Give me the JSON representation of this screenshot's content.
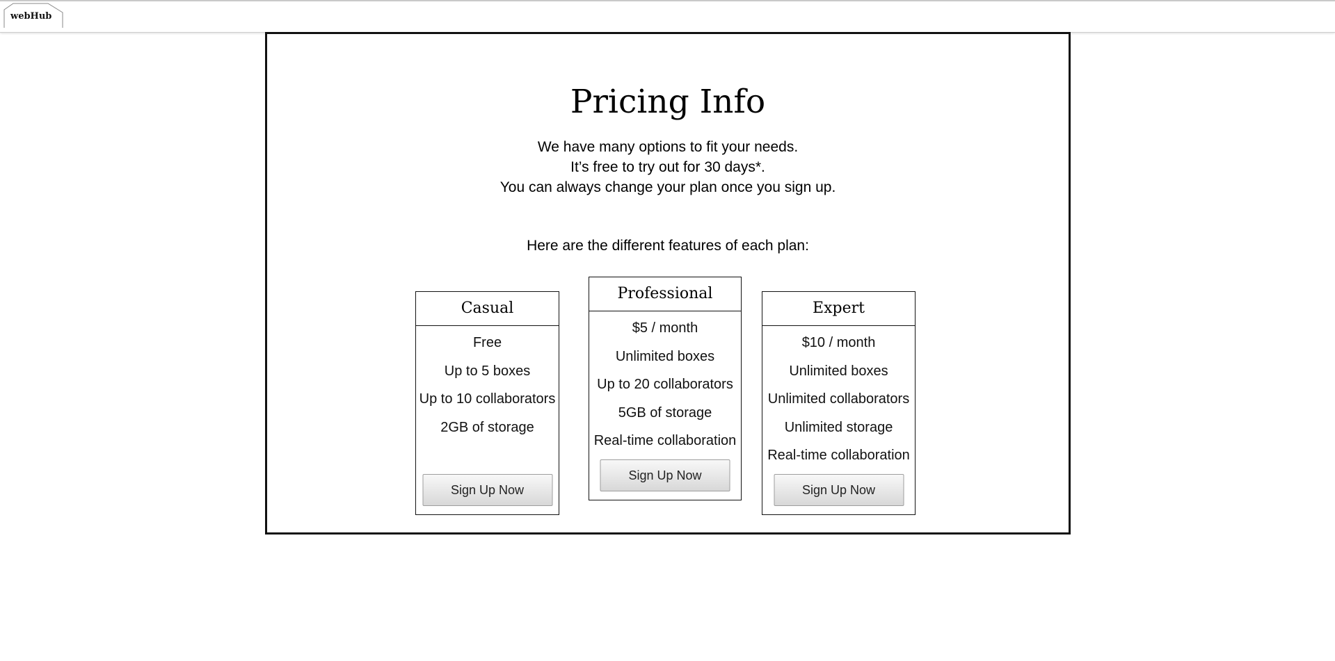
{
  "app": {
    "logo_text": "webHub"
  },
  "main": {
    "title": "Pricing Info",
    "intro_lines": [
      "We have many options to fit your needs.",
      "It’s free to try out for 30 days*.",
      "You can always change your plan once you sign up."
    ],
    "features_heading": "Here are the different features of each plan:"
  },
  "plans": [
    {
      "name": "Casual",
      "features": [
        "Free",
        "Up to 5 boxes",
        "Up to 10 collaborators",
        "2GB of storage"
      ],
      "button_label": "Sign Up Now"
    },
    {
      "name": "Professional",
      "features": [
        "$5 / month",
        "Unlimited boxes",
        "Up to 20 collaborators",
        "5GB of storage",
        "Real-time collaboration"
      ],
      "button_label": "Sign Up Now"
    },
    {
      "name": "Expert",
      "features": [
        "$10 / month",
        "Unlimited boxes",
        "Unlimited collaborators",
        "Unlimited storage",
        "Real-time collaboration"
      ],
      "button_label": "Sign Up Now"
    }
  ]
}
